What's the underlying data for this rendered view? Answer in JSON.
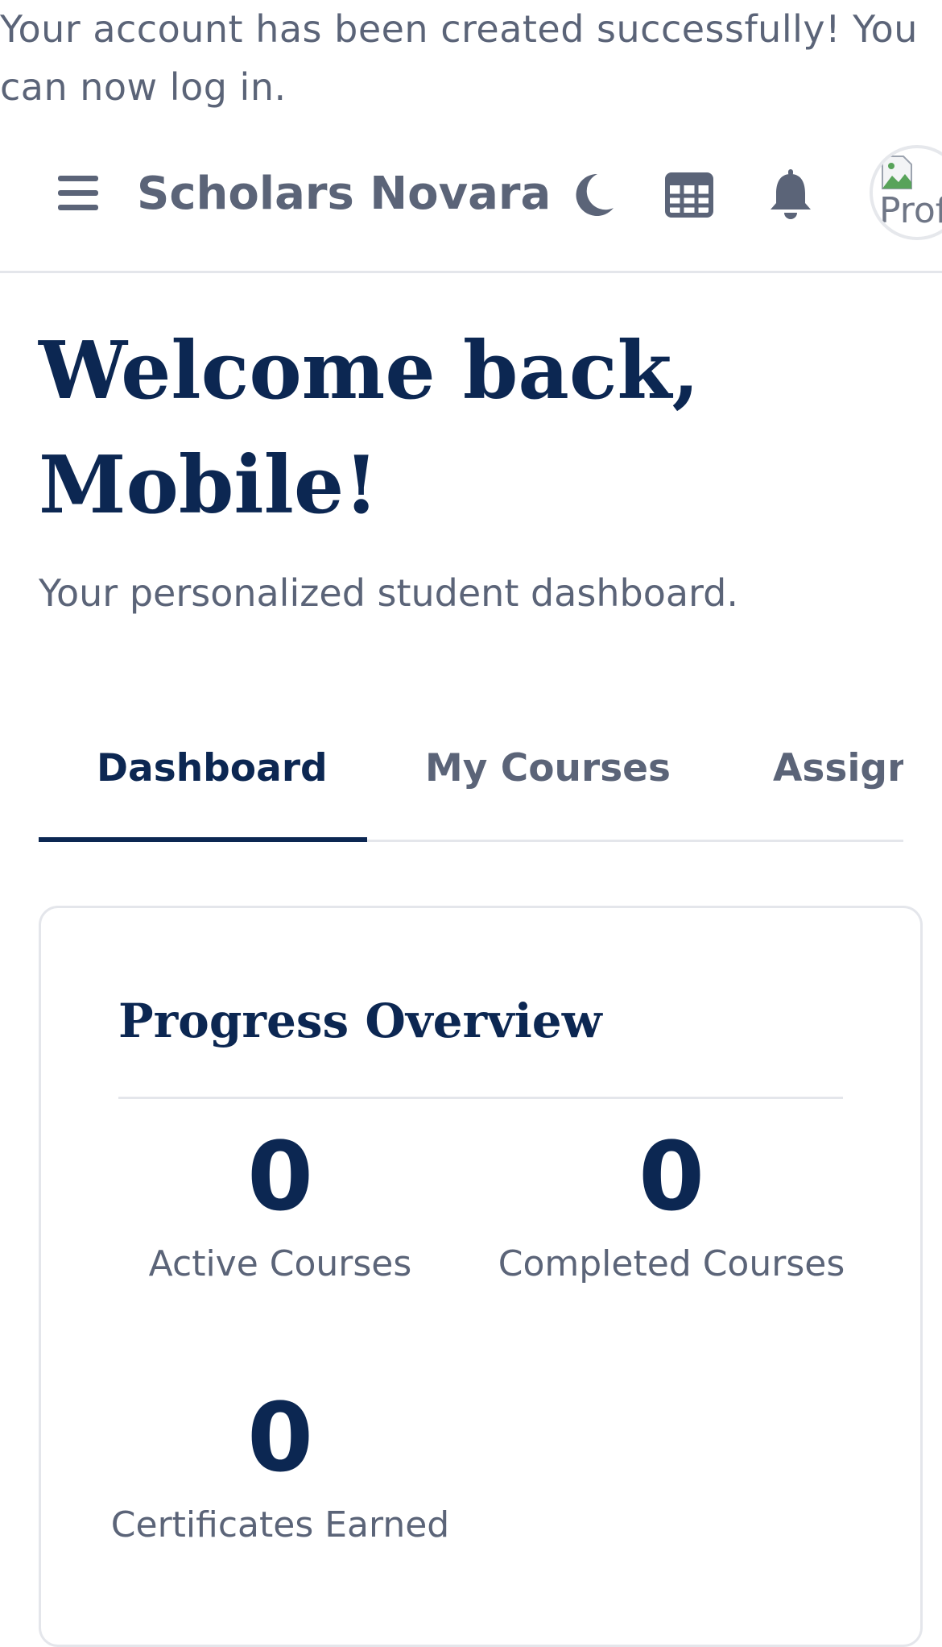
{
  "flash": {
    "message": "Your account has been created successfully! You can now log in."
  },
  "navbar": {
    "menu_icon": "hamburger-menu-icon",
    "brand": "Scholars Novara",
    "theme_icon": "moon-icon",
    "apps_icon": "grid-icon",
    "notifications_icon": "bell-icon",
    "avatar_alt": "Profile"
  },
  "header": {
    "welcome": "Welcome back, Mobile!",
    "subtitle": "Your personalized student dashboard."
  },
  "tabs": [
    {
      "label": "Dashboard",
      "active": true
    },
    {
      "label": "My Courses",
      "active": false
    },
    {
      "label": "Assignments",
      "active": false
    }
  ],
  "progress": {
    "title": "Progress Overview",
    "stats": [
      {
        "value": "0",
        "label": "Active Courses"
      },
      {
        "value": "0",
        "label": "Completed Courses"
      },
      {
        "value": "0",
        "label": "Certificates Earned"
      }
    ]
  },
  "colors": {
    "primary": "#0c2752",
    "muted_text": "#5b6478",
    "border": "#e4e6eb"
  }
}
